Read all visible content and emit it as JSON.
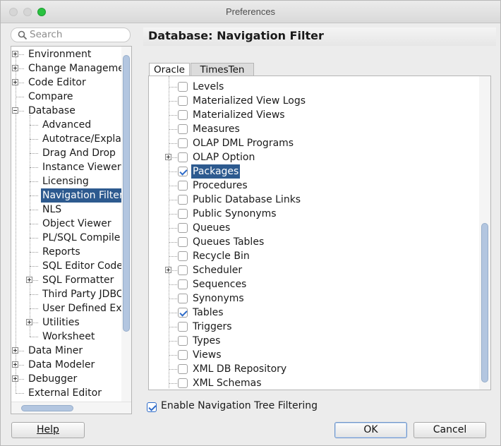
{
  "window": {
    "title": "Preferences"
  },
  "search": {
    "placeholder": "Search"
  },
  "left_tree": {
    "items": [
      {
        "label": "Environment",
        "expandable": true
      },
      {
        "label": "Change Manageme",
        "expandable": true
      },
      {
        "label": "Code Editor",
        "expandable": true
      },
      {
        "label": "Compare",
        "expandable": false
      },
      {
        "label": "Database",
        "expandable": true,
        "expanded": true
      },
      {
        "label": "Advanced",
        "child": true
      },
      {
        "label": "Autotrace/Expla",
        "child": true
      },
      {
        "label": "Drag And Drop",
        "child": true
      },
      {
        "label": "Instance Viewer",
        "child": true
      },
      {
        "label": "Licensing",
        "child": true
      },
      {
        "label": "Navigation Filter",
        "child": true,
        "selected": true
      },
      {
        "label": "NLS",
        "child": true
      },
      {
        "label": "Object Viewer",
        "child": true
      },
      {
        "label": "PL/SQL Compile",
        "child": true
      },
      {
        "label": "Reports",
        "child": true
      },
      {
        "label": "SQL Editor Code",
        "child": true
      },
      {
        "label": "SQL Formatter",
        "child": true,
        "expandable": true
      },
      {
        "label": "Third Party JDBC",
        "child": true
      },
      {
        "label": "User Defined Ext",
        "child": true
      },
      {
        "label": "Utilities",
        "child": true,
        "expandable": true
      },
      {
        "label": "Worksheet",
        "child": true
      },
      {
        "label": "Data Miner",
        "expandable": true
      },
      {
        "label": "Data Modeler",
        "expandable": true
      },
      {
        "label": "Debugger",
        "expandable": true
      },
      {
        "label": "External Editor",
        "expandable": false
      }
    ]
  },
  "page_title": "Database: Navigation Filter",
  "tabs": [
    {
      "label": "Oracle",
      "active": true
    },
    {
      "label": "TimesTen",
      "active": false
    }
  ],
  "filter_list": {
    "items": [
      {
        "label": "Levels",
        "checked": false
      },
      {
        "label": "Materialized View Logs",
        "checked": false
      },
      {
        "label": "Materialized Views",
        "checked": false
      },
      {
        "label": "Measures",
        "checked": false
      },
      {
        "label": "OLAP DML Programs",
        "checked": false
      },
      {
        "label": "OLAP Option",
        "checked": false,
        "expandable": true
      },
      {
        "label": "Packages",
        "checked": true,
        "selected": true
      },
      {
        "label": "Procedures",
        "checked": false
      },
      {
        "label": "Public Database Links",
        "checked": false
      },
      {
        "label": "Public Synonyms",
        "checked": false
      },
      {
        "label": "Queues",
        "checked": false
      },
      {
        "label": "Queues Tables",
        "checked": false
      },
      {
        "label": "Recycle Bin",
        "checked": false
      },
      {
        "label": "Scheduler",
        "checked": false,
        "expandable": true
      },
      {
        "label": "Sequences",
        "checked": false
      },
      {
        "label": "Synonyms",
        "checked": false
      },
      {
        "label": "Tables",
        "checked": true
      },
      {
        "label": "Triggers",
        "checked": false
      },
      {
        "label": "Types",
        "checked": false
      },
      {
        "label": "Views",
        "checked": false
      },
      {
        "label": "XML DB Repository",
        "checked": false
      },
      {
        "label": "XML Schemas",
        "checked": false
      }
    ]
  },
  "enable_filtering": {
    "label": "Enable Navigation Tree Filtering",
    "checked": true
  },
  "buttons": {
    "help": "Help",
    "ok": "OK",
    "cancel": "Cancel"
  },
  "colors": {
    "selection": "#2d5a8f",
    "check": "#2f6cc9",
    "scroll_thumb": "#b3c6e0"
  }
}
